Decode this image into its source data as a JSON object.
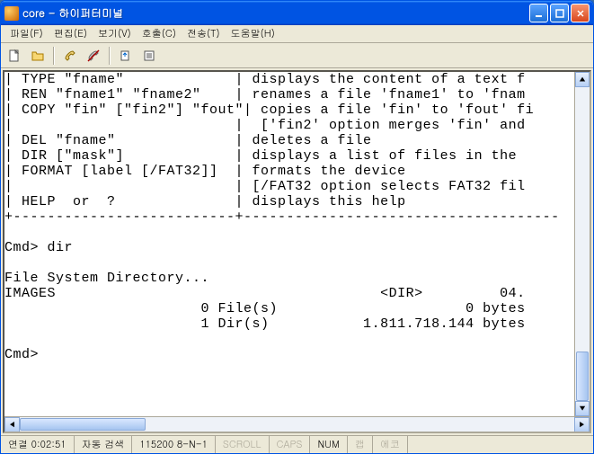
{
  "title": "core - 하이퍼터미널",
  "menu": {
    "file": "파일(F)",
    "edit": "편집(E)",
    "view": "보기(V)",
    "call": "호출(C)",
    "transfer": "전송(T)",
    "help": "도움말(H)"
  },
  "terminal_lines": [
    "| TYPE \"fname\"             | displays the content of a text f",
    "| REN \"fname1\" \"fname2\"    | renames a file 'fname1' to 'fnam",
    "| COPY \"fin\" [\"fin2\"] \"fout\"| copies a file 'fin' to 'fout' fi",
    "|                          |  ['fin2' option merges 'fin' and",
    "| DEL \"fname\"              | deletes a file",
    "| DIR [\"mask\"]             | displays a list of files in the ",
    "| FORMAT [label [/FAT32]]  | formats the device",
    "|                          | [/FAT32 option selects FAT32 fil",
    "| HELP  or  ?              | displays this help",
    "+--------------------------+-------------------------------------",
    "",
    "Cmd> dir",
    "",
    "File System Directory...",
    "IMAGES                                      <DIR>         04.",
    "                       0 File(s)                      0 bytes",
    "                       1 Dir(s)           1.811.718.144 bytes",
    "",
    "Cmd>",
    ""
  ],
  "status": {
    "connected": "연결 0:02:51",
    "autodetect": "자동 검색",
    "port": "115200 8-N-1",
    "scroll": "SCROLL",
    "caps": "CAPS",
    "num": "NUM",
    "cap": "캡",
    "echo": "에코"
  }
}
